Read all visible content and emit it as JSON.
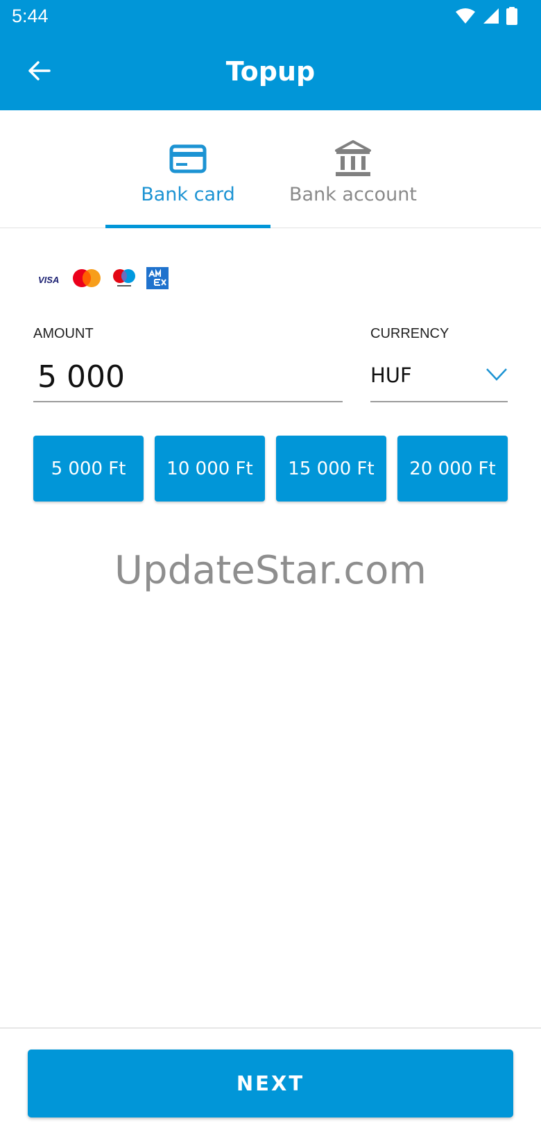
{
  "status_bar": {
    "time": "5:44",
    "icons": [
      "wifi-icon",
      "cellular-signal-icon",
      "battery-icon"
    ]
  },
  "app_bar": {
    "title": "Topup",
    "back_icon": "arrow-back-icon"
  },
  "tabs": [
    {
      "label": "Bank card",
      "icon": "credit-card-icon",
      "selected": true
    },
    {
      "label": "Bank account",
      "icon": "bank-building-icon",
      "selected": false
    }
  ],
  "card_brands": {
    "visa": "VISA",
    "others": [
      "mastercard-logo",
      "maestro-logo",
      "amex-logo"
    ]
  },
  "amount": {
    "label": "AMOUNT",
    "value": "5 000"
  },
  "currency": {
    "label": "CURRENCY",
    "value": "HUF"
  },
  "quick_amounts": [
    "5 000 Ft",
    "10 000 Ft",
    "15 000 Ft",
    "20 000 Ft"
  ],
  "watermark": "UpdateStar.com",
  "next_button": "NEXT",
  "colors": {
    "primary": "#0196d8",
    "tab_selected_text": "#1c93d3",
    "tab_unselected_text": "#8a8a8a"
  }
}
